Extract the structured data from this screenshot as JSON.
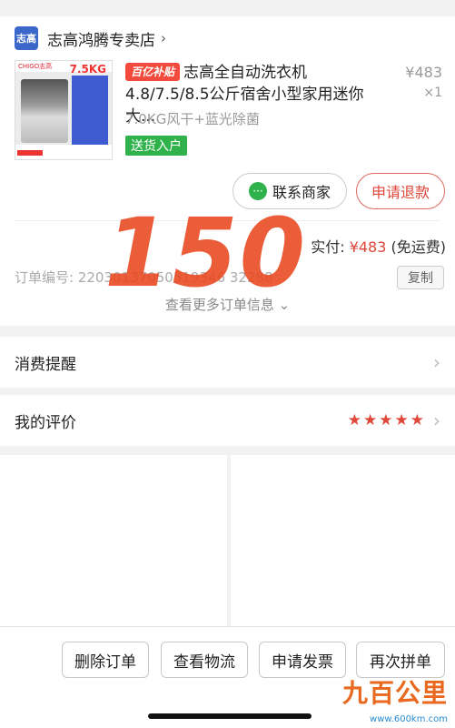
{
  "shop": {
    "logo_text": "志高",
    "name": "志高鸿腾专卖店",
    "chevron": "›"
  },
  "product": {
    "thumbnail": {
      "brand": "CHIGO志高",
      "capacity": "7.5KG"
    },
    "subsidy_tag": "百亿补贴",
    "title": "志高全自动洗衣机4.8/7.5/8.5公斤宿舍小型家用迷你大...",
    "price": "¥483",
    "quantity": "×1",
    "spec": "7.0KG风干+蓝光除菌",
    "delivery_tag": "送货入户"
  },
  "actions": {
    "contact": "联系商家",
    "refund": "申请退款"
  },
  "payment": {
    "label": "实付:",
    "amount": "¥483",
    "note": "(免运费)"
  },
  "order": {
    "label": "订单编号:",
    "number": "22030137050519346 32288",
    "copy": "复制",
    "more": "查看更多订单信息"
  },
  "stamp": {
    "value": "150"
  },
  "reminder": {
    "label": "消费提醒"
  },
  "review": {
    "label": "我的评价",
    "rating": 5,
    "stars": "★★★★★"
  },
  "bottom_actions": {
    "delete": "删除订单",
    "track": "查看物流",
    "invoice": "申请发票",
    "rebuy": "再次拼单"
  },
  "watermark": {
    "logo": "九百公里",
    "url": "www.600km.com"
  },
  "colors": {
    "accent": "#e0463a",
    "green": "#2fb24b",
    "shop_blue": "#3a67c9"
  }
}
